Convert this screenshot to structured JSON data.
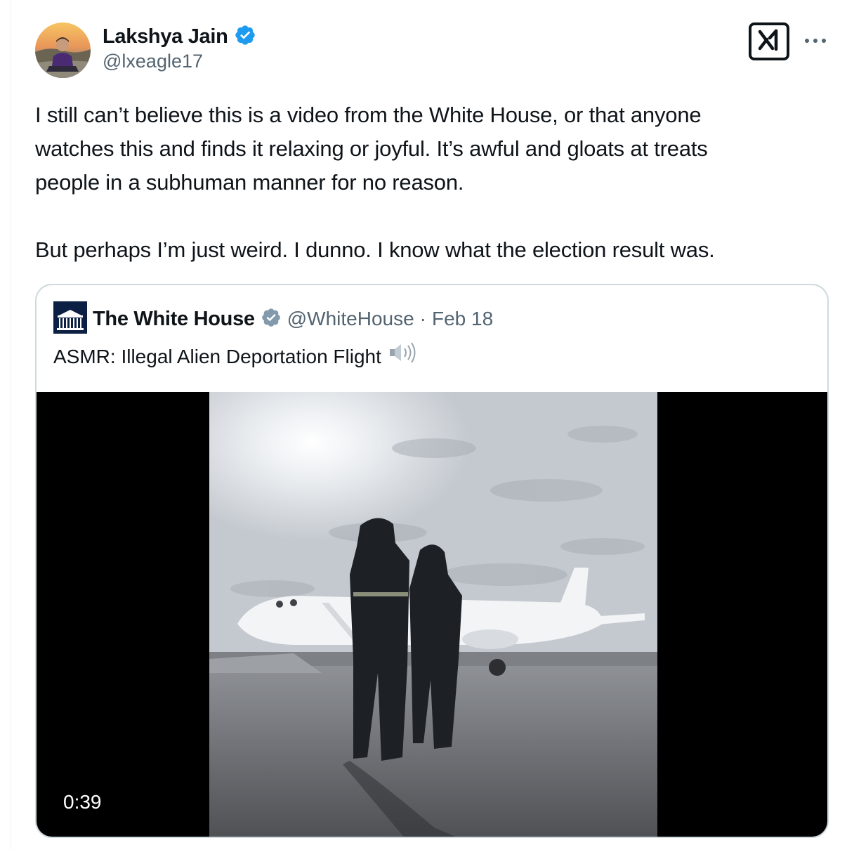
{
  "post": {
    "author": {
      "name": "Lakshya Jain",
      "handle": "@lxeagle17",
      "verified": true,
      "avatar": "avatar-photo"
    },
    "text_lines": [
      "I still can’t believe this is a video from the White House, or that anyone",
      "watches this and finds it relaxing or joyful. It’s awful and gloats at treats",
      "people in a subhuman manner for no reason.",
      "",
      "But perhaps I’m just weird. I dunno. I know what the election result was."
    ],
    "actions": {
      "grok_icon": "grok-icon",
      "more_icon": "more-horizontal-icon"
    }
  },
  "quoted_post": {
    "author": {
      "name": "The White House",
      "handle": "@WhiteHouse",
      "separator": "·",
      "date": "Feb 18",
      "verified_badge": "gray-verified-icon",
      "avatar": "white-house-logo"
    },
    "text": "ASMR: Illegal Alien Deportation Flight",
    "emoji": "speaker-high-volume-icon",
    "video": {
      "duration": "0:39",
      "scene": "airplane-on-tarmac"
    }
  },
  "colors": {
    "text_primary": "#0f1419",
    "text_secondary": "#536471",
    "verified_blue": "#1d9bf0",
    "verified_gray": "#829aab",
    "border": "#cfd9de"
  }
}
